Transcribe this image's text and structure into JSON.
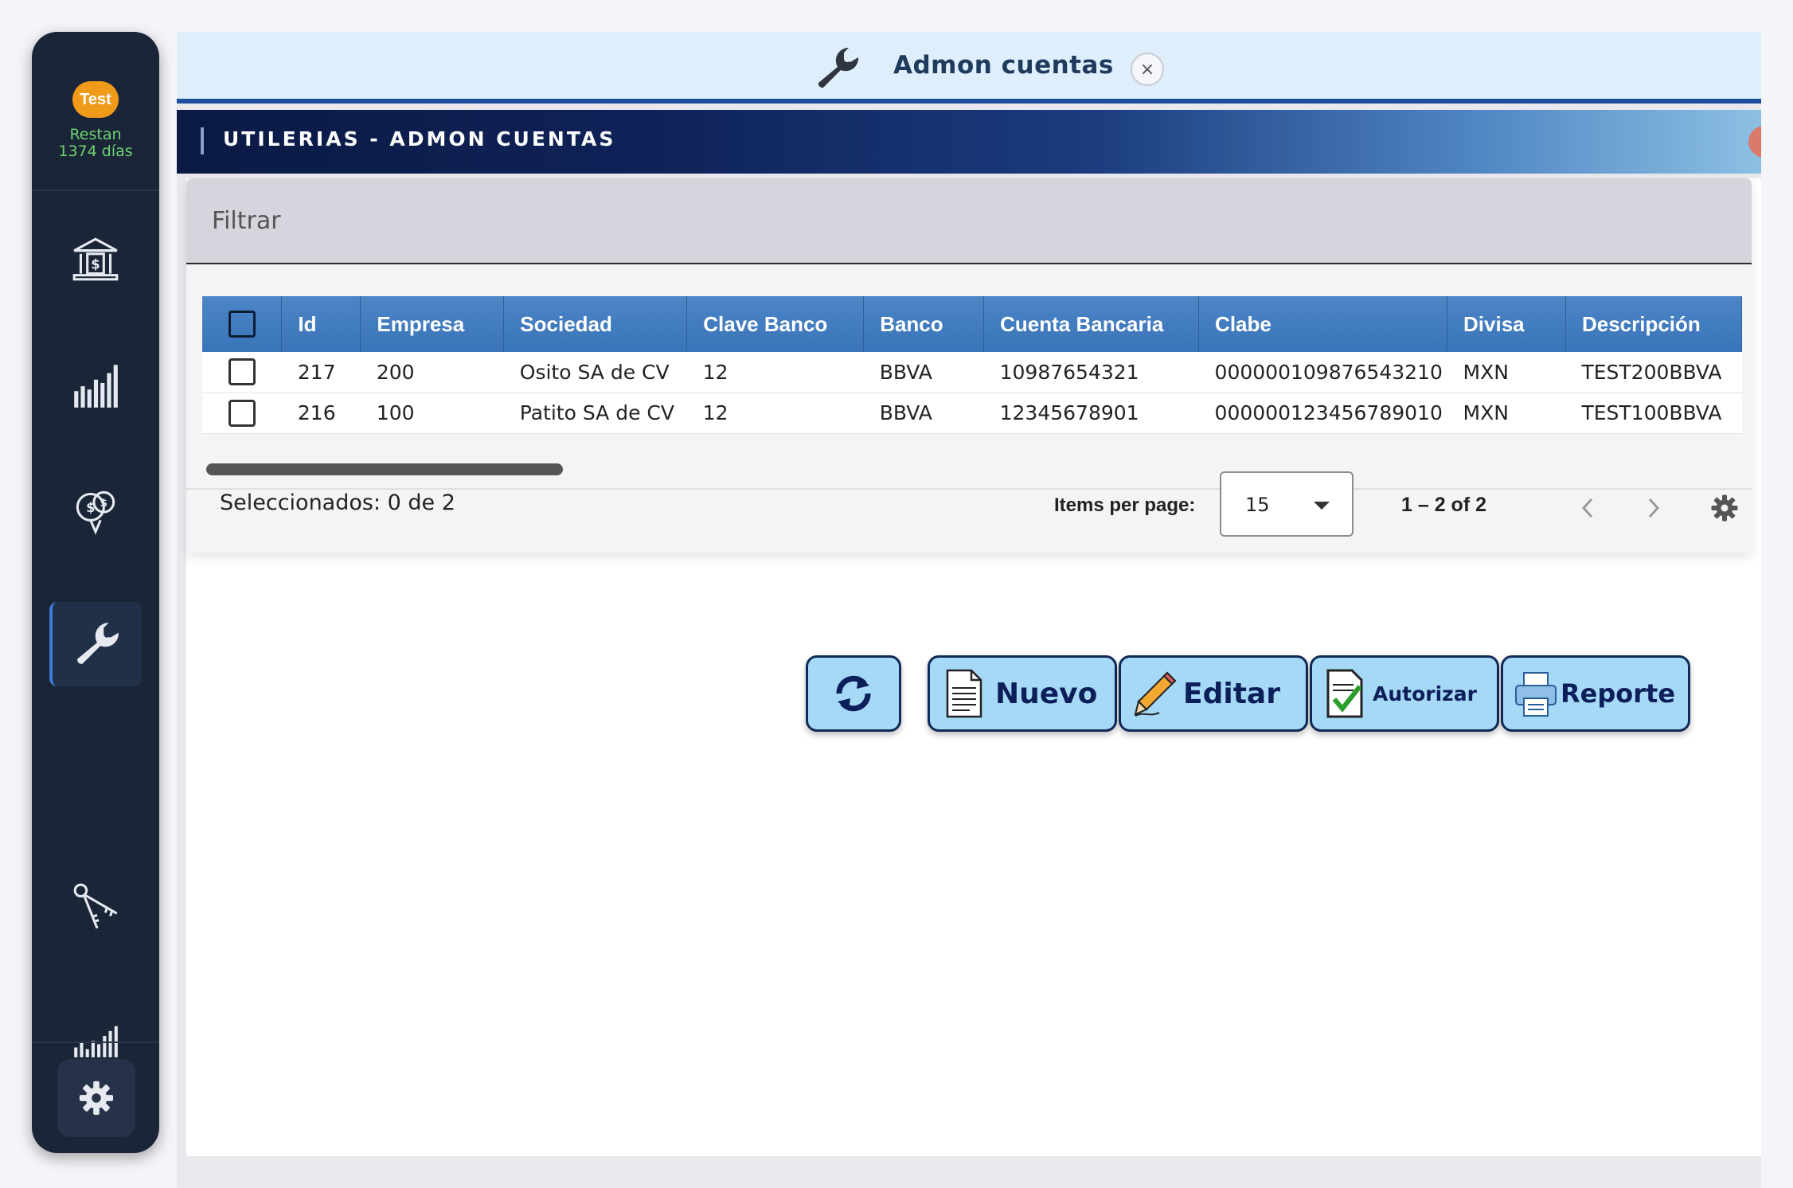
{
  "sidebar": {
    "badge": "Test",
    "remaining_line1": "Restan",
    "remaining_line2": "1374 días",
    "items": [
      {
        "icon": "bank-icon"
      },
      {
        "icon": "bar-chart-icon"
      },
      {
        "icon": "money-map-icon"
      },
      {
        "icon": "wrench-icon",
        "active": true
      },
      {
        "icon": "keys-icon"
      },
      {
        "icon": "small-bar-chart-icon"
      }
    ],
    "settings_icon": "gear-icon"
  },
  "tab": {
    "title": "Admon cuentas",
    "close": "×"
  },
  "banner": {
    "title": "UTILERIAS - ADMON CUENTAS"
  },
  "filter": {
    "label": "Filtrar"
  },
  "table": {
    "columns": [
      "Id",
      "Empresa",
      "Sociedad",
      "Clave Banco",
      "Banco",
      "Cuenta Bancaria",
      "Clabe",
      "Divisa",
      "Descripción"
    ],
    "rows": [
      [
        "217",
        "200",
        "Osito SA de CV",
        "12",
        "BBVA",
        "10987654321",
        "000000109876543210",
        "MXN",
        "TEST200BBVA"
      ],
      [
        "216",
        "100",
        "Patito SA de CV",
        "12",
        "BBVA",
        "12345678901",
        "000000123456789010",
        "MXN",
        "TEST100BBVA"
      ]
    ]
  },
  "footer": {
    "selected": "Seleccionados: 0 de 2",
    "items_per_page_label": "Items per page:",
    "items_per_page_value": "15",
    "range": "1 – 2 of 2"
  },
  "actions": {
    "nuevo": "Nuevo",
    "editar": "Editar",
    "autorizar": "Autorizar",
    "reporte": "Reporte"
  },
  "colors": {
    "sidebar_bg": "#1a2538",
    "accent_blue": "#3974b8",
    "button_bg": "#a6d9f6",
    "badge_orange": "#f09a1a",
    "remain_green": "#6fd36f"
  }
}
